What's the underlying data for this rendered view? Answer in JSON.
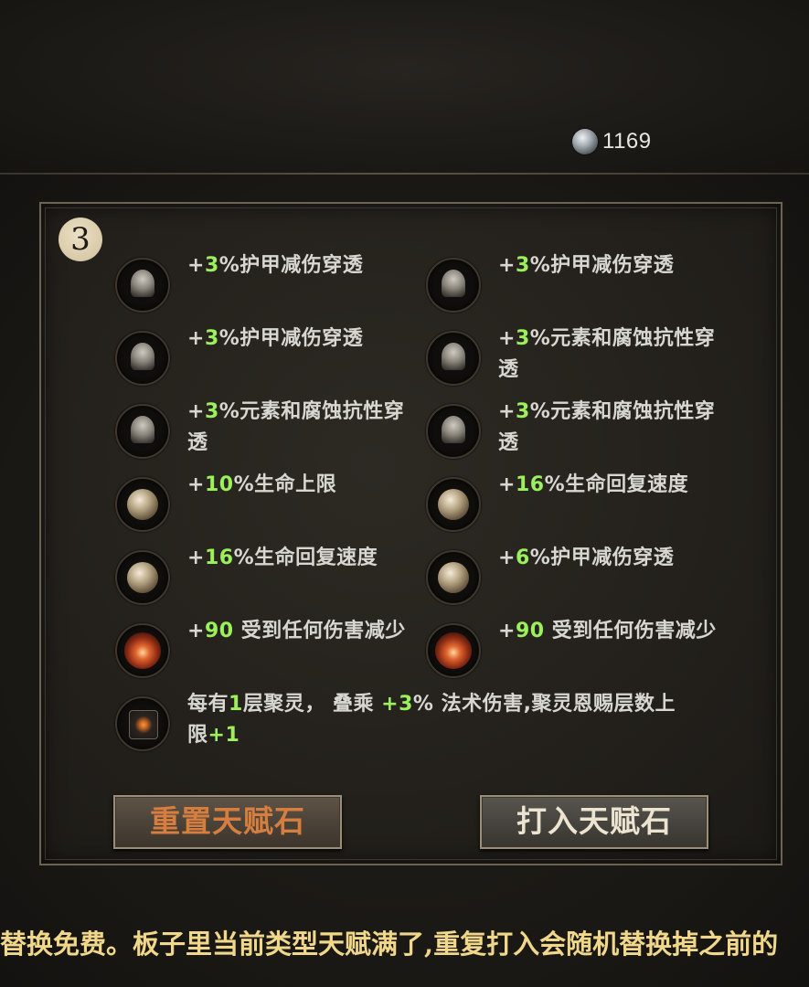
{
  "currency": {
    "icon": "silver-coin-icon",
    "value": "1169"
  },
  "panel": {
    "slot_number": "3",
    "items": [
      {
        "icon": "helmet-icon",
        "prefix": "+",
        "value": "3",
        "suffix": "%护甲减伤穿透",
        "line2": ""
      },
      {
        "icon": "helmet-icon",
        "prefix": "+",
        "value": "3",
        "suffix": "%护甲减伤穿透",
        "line2": ""
      },
      {
        "icon": "helmet-icon",
        "prefix": "+",
        "value": "3",
        "suffix": "%护甲减伤穿透",
        "line2": ""
      },
      {
        "icon": "helmet-icon",
        "prefix": "+",
        "value": "3",
        "suffix": "%元素和腐蚀抗性穿",
        "line2": "透"
      },
      {
        "icon": "helmet-icon",
        "prefix": "+",
        "value": "3",
        "suffix": "%元素和腐蚀抗性穿",
        "line2": "透"
      },
      {
        "icon": "helmet-icon",
        "prefix": "+",
        "value": "3",
        "suffix": "%元素和腐蚀抗性穿",
        "line2": "透"
      },
      {
        "icon": "orb-icon",
        "prefix": "+",
        "value": "10",
        "suffix": "%生命上限",
        "line2": ""
      },
      {
        "icon": "orb-icon",
        "prefix": "+",
        "value": "16",
        "suffix": "%生命回复速度",
        "line2": ""
      },
      {
        "icon": "orb-icon",
        "prefix": "+",
        "value": "16",
        "suffix": "%生命回复速度",
        "line2": ""
      },
      {
        "icon": "orb-icon",
        "prefix": "+",
        "value": "6",
        "suffix": "%护甲减伤穿透",
        "line2": ""
      },
      {
        "icon": "fire-icon",
        "prefix": "+",
        "value": "90",
        "suffix": " 受到任何伤害减少",
        "line2": ""
      },
      {
        "icon": "fire-icon",
        "prefix": "+",
        "value": "90",
        "suffix": " 受到任何伤害减少",
        "line2": ""
      }
    ],
    "special": {
      "icon": "rune-icon",
      "part1": "每有",
      "value1": "1",
      "part2": "层聚灵， 叠乘 ",
      "value2": "+3",
      "part3": "% 法术伤害,聚灵恩赐层数上",
      "part4": "限",
      "value3": "+1"
    },
    "buttons": {
      "reset_label": "重置天赋石",
      "socket_label": "打入天赋石"
    }
  },
  "footer_text": "替换免费。板子里当前类型天赋满了,重复打入会随机替换掉之前的"
}
